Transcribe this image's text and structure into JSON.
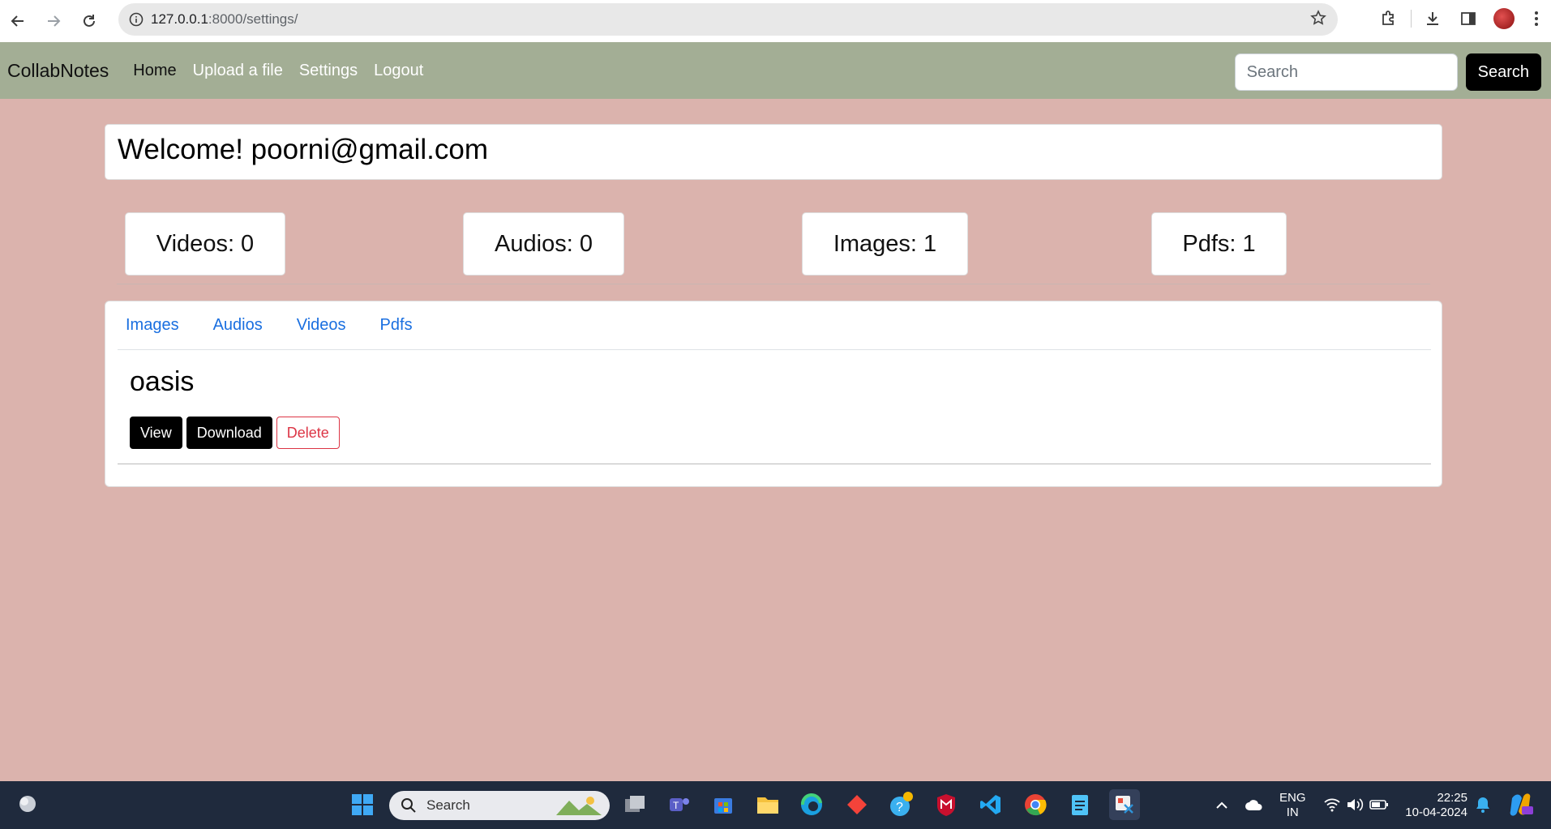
{
  "browser": {
    "url_host": "127.0.0.1",
    "url_path": ":8000/settings/"
  },
  "navbar": {
    "brand": "CollabNotes",
    "links": [
      "Home",
      "Upload a file",
      "Settings",
      "Logout"
    ],
    "search_placeholder": "Search",
    "search_button": "Search"
  },
  "welcome": {
    "text": "Welcome! poorni@gmail.com"
  },
  "stats": [
    {
      "label": "Videos: 0"
    },
    {
      "label": "Audios: 0"
    },
    {
      "label": "Images: 1"
    },
    {
      "label": "Pdfs: 1"
    }
  ],
  "tabs": [
    "Images",
    "Audios",
    "Videos",
    "Pdfs"
  ],
  "file": {
    "title": "oasis",
    "view_label": "View",
    "download_label": "Download",
    "delete_label": "Delete"
  },
  "taskbar": {
    "search_label": "Search",
    "lang_line1": "ENG",
    "lang_line2": "IN",
    "time": "22:25",
    "date": "10-04-2024"
  }
}
